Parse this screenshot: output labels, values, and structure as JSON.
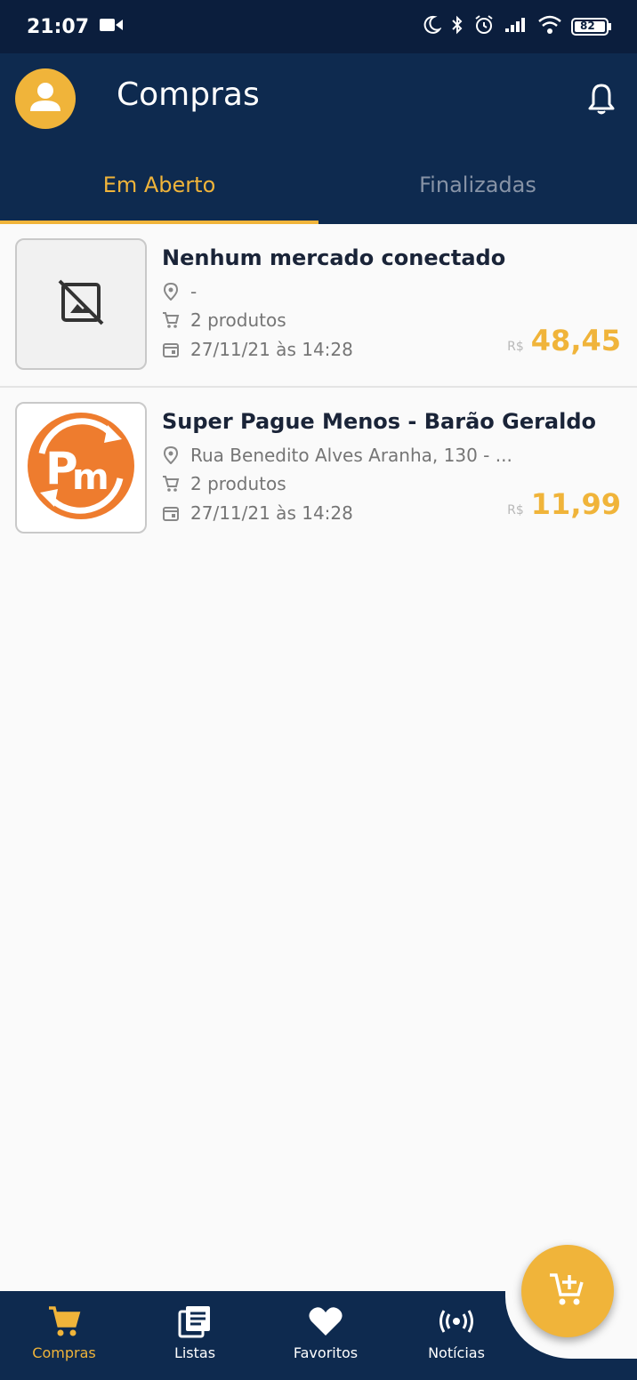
{
  "status_bar": {
    "time": "21:07",
    "battery": "82",
    "icons": [
      "video-camera-icon",
      "moon-icon",
      "bluetooth-icon",
      "alarm-icon",
      "signal-icon",
      "wifi-icon",
      "battery-icon"
    ]
  },
  "app_bar": {
    "title": "Compras",
    "icons": [
      "avatar-icon",
      "bell-icon"
    ]
  },
  "tabs": [
    {
      "label": "Em Aberto",
      "active": true
    },
    {
      "label": "Finalizadas",
      "active": false
    }
  ],
  "purchases": [
    {
      "name": "Nenhum mercado conectado",
      "address": "-",
      "products": "2 produtos",
      "date": "27/11/21 às 14:28",
      "currency": "R$",
      "total": "48,45",
      "thumb": "no-image-icon"
    },
    {
      "name": "Super Pague Menos - Barão Geraldo",
      "address": "Rua Benedito Alves Aranha, 130 - ...",
      "products": "2 produtos",
      "date": "27/11/21 às 14:28",
      "currency": "R$",
      "total": "11,99",
      "thumb": "pague-menos-logo"
    }
  ],
  "bottom_nav": [
    {
      "label": "Compras",
      "icon": "cart-icon",
      "active": true
    },
    {
      "label": "Listas",
      "icon": "list-icon",
      "active": false
    },
    {
      "label": "Favoritos",
      "icon": "heart-icon",
      "active": false
    },
    {
      "label": "Notícias",
      "icon": "broadcast-icon",
      "active": false
    }
  ],
  "fab": {
    "icon": "add-cart-icon"
  },
  "colors": {
    "primary": "#0e2a4f",
    "status_bar": "#0b1e3d",
    "accent": "#f0b43a",
    "background": "#fafafa"
  }
}
